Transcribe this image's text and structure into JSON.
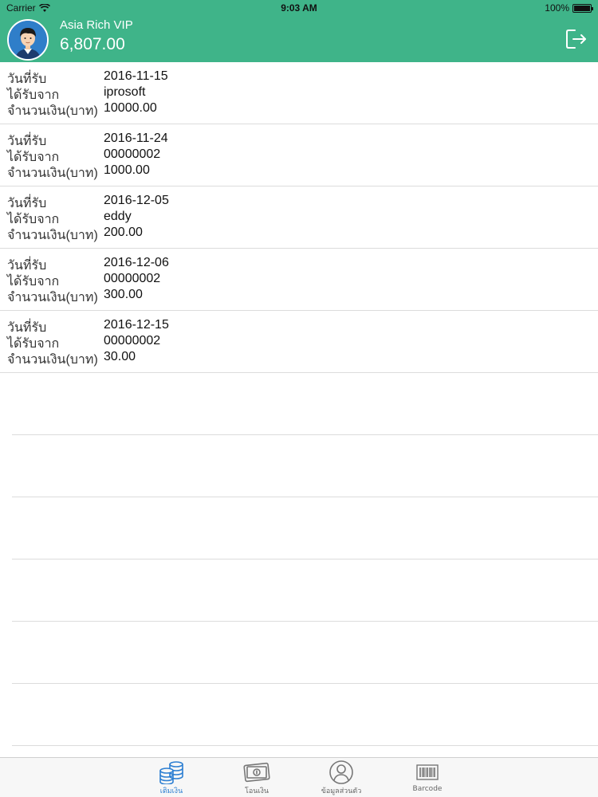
{
  "status": {
    "carrier": "Carrier",
    "time": "9:03 AM",
    "battery": "100%"
  },
  "account": {
    "name": "Asia Rich VIP",
    "balance": "6,807.00"
  },
  "labels": {
    "date": "วันที่รับ",
    "from": "ได้รับจาก",
    "amount": "จำนวนเงิน(บาท)"
  },
  "rows": [
    {
      "date": "2016-11-15",
      "from": "iprosoft",
      "amount": "10000.00"
    },
    {
      "date": "2016-11-24",
      "from": "00000002",
      "amount": "1000.00"
    },
    {
      "date": "2016-12-05",
      "from": "eddy",
      "amount": "200.00"
    },
    {
      "date": "2016-12-06",
      "from": "00000002",
      "amount": "300.00"
    },
    {
      "date": "2016-12-15",
      "from": "00000002",
      "amount": "30.00"
    }
  ],
  "tabs": [
    {
      "label": "เติมเงิน",
      "icon": "coins-icon",
      "active": true
    },
    {
      "label": "โอนเงิน",
      "icon": "money-transfer-icon",
      "active": false
    },
    {
      "label": "ข้อมูลส่วนตัว",
      "icon": "profile-icon",
      "active": false
    },
    {
      "label": "Barcode",
      "icon": "barcode-icon",
      "active": false
    }
  ],
  "colors": {
    "header": "#3fb489",
    "active_tab": "#2d7fd2"
  }
}
